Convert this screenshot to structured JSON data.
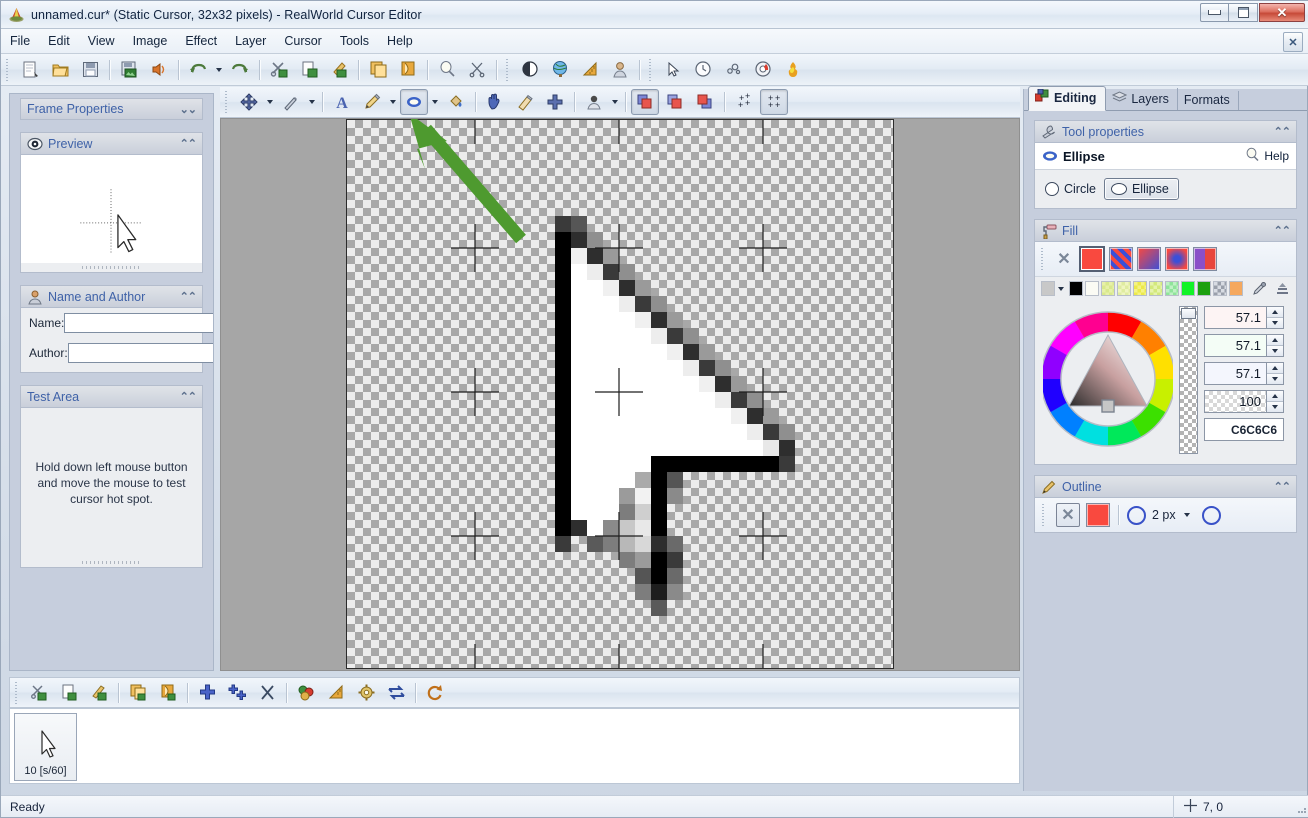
{
  "window": {
    "title": "unnamed.cur* (Static Cursor, 32x32 pixels) - RealWorld Cursor Editor",
    "app_icon": "realworld-app-icon",
    "minimize_label": "",
    "maximize_label": "",
    "close_label": "✕"
  },
  "menubar": {
    "items": [
      {
        "label": "File"
      },
      {
        "label": "Edit"
      },
      {
        "label": "View"
      },
      {
        "label": "Image"
      },
      {
        "label": "Effect"
      },
      {
        "label": "Layer"
      },
      {
        "label": "Cursor"
      },
      {
        "label": "Tools"
      },
      {
        "label": "Help"
      }
    ],
    "document_close_label": "✕"
  },
  "main_toolbar": {
    "buttons": [
      {
        "name": "new-icon",
        "tip": "New"
      },
      {
        "name": "open-folder-icon",
        "tip": "Open"
      },
      {
        "name": "save-floppy-icon",
        "tip": "Save"
      },
      {
        "name": "import-image-icon",
        "tip": "Import"
      },
      {
        "name": "sound-icon",
        "tip": "Sound"
      },
      {
        "name": "undo-icon",
        "tip": "Undo"
      },
      {
        "name": "redo-icon",
        "tip": "Redo"
      },
      {
        "name": "cut-scissors-icon",
        "tip": "Cut"
      },
      {
        "name": "copy-icon",
        "tip": "Copy"
      },
      {
        "name": "paste-brush-icon",
        "tip": "Paste"
      },
      {
        "name": "duplicate-layer-icon",
        "tip": "Duplicate"
      },
      {
        "name": "delete-layer-icon",
        "tip": "Delete"
      },
      {
        "name": "bulb-hint-icon",
        "tip": "Hint"
      },
      {
        "name": "scissors-tool-icon",
        "tip": "Trim"
      },
      {
        "name": "contrast-icon",
        "tip": "Contrast"
      },
      {
        "name": "globe-icon",
        "tip": "Globe"
      },
      {
        "name": "ruler-icon",
        "tip": "Measure"
      },
      {
        "name": "person-icon",
        "tip": "Avatar"
      },
      {
        "name": "arrow-pointer-icon",
        "tip": "Select"
      },
      {
        "name": "clock-icon",
        "tip": "Timing"
      },
      {
        "name": "bubbles-icon",
        "tip": "Effects"
      },
      {
        "name": "lifebuoy-icon",
        "tip": "Help"
      },
      {
        "name": "flame-icon",
        "tip": "Burn"
      }
    ]
  },
  "tool_options": {
    "buttons": [
      {
        "name": "move-tool-icon",
        "has_caret": true,
        "pressed": false
      },
      {
        "name": "select-wand-icon",
        "has_caret": true,
        "pressed": false
      },
      {
        "name": "text-tool-icon",
        "has_caret": false,
        "pressed": false
      },
      {
        "name": "pencil-tool-icon",
        "has_caret": true,
        "pressed": false
      },
      {
        "name": "ellipse-tool-icon",
        "has_caret": true,
        "pressed": true
      },
      {
        "name": "fill-bucket-icon",
        "has_caret": false,
        "pressed": false
      },
      {
        "name": "hand-pan-icon",
        "has_caret": false,
        "pressed": false
      },
      {
        "name": "eraser-tool-icon",
        "has_caret": false,
        "pressed": false
      },
      {
        "name": "hotspot-crosshair-icon",
        "has_caret": false,
        "pressed": false
      },
      {
        "name": "avatar-tool-icon",
        "has_caret": true,
        "pressed": false
      },
      {
        "name": "layer-front-icon",
        "has_caret": false,
        "pressed": true
      },
      {
        "name": "layer-middle-icon",
        "has_caret": false,
        "pressed": false
      },
      {
        "name": "layer-back-icon",
        "has_caret": false,
        "pressed": false
      },
      {
        "name": "grid-off-icon",
        "has_caret": false,
        "pressed": false
      },
      {
        "name": "grid-on-icon",
        "has_caret": false,
        "pressed": true
      }
    ]
  },
  "left_panel": {
    "frame_properties": {
      "title": "Frame Properties",
      "collapsed": true,
      "chevron": "⌄⌄"
    },
    "preview": {
      "title": "Preview",
      "icon": "eye-icon",
      "chevron": "⌃⌃"
    },
    "name_and_author": {
      "title": "Name and Author",
      "icon": "person-icon",
      "chevron": "⌃⌃",
      "fields": [
        {
          "label": "Name:",
          "value": "",
          "placeholder": ""
        },
        {
          "label": "Author:",
          "value": "",
          "placeholder": ""
        }
      ]
    },
    "test_area": {
      "title": "Test Area",
      "chevron": "⌃⌃",
      "instructions": "Hold down left mouse button and move the mouse to test cursor hot spot."
    }
  },
  "right_panel": {
    "tabs": [
      {
        "label": "Editing",
        "icon": "editing-cubes-icon",
        "active": true
      },
      {
        "label": "Layers",
        "icon": "layers-stack-icon",
        "active": false
      },
      {
        "label": "Formats",
        "icon": "",
        "active": false
      }
    ],
    "tool_properties": {
      "title": "Tool properties",
      "icon": "wrench-icon",
      "chevron": "⌃⌃",
      "tool_name": "Ellipse",
      "tool_icon": "ellipse-icon",
      "help_label": "Help",
      "help_icon": "bulb-icon",
      "shape_options": [
        {
          "label": "Circle",
          "selected": false
        },
        {
          "label": "Ellipse",
          "selected": true
        }
      ]
    },
    "fill": {
      "title": "Fill",
      "icon": "paint-roller-icon",
      "chevron": "⌃⌃",
      "no_fill_icon": "no-fill-x-icon",
      "styles": [
        {
          "name": "solid-fill-swatch",
          "selected": true,
          "color": "#f9493f"
        },
        {
          "name": "hatch-fill-swatch",
          "selected": false,
          "color": "#3b4fd8"
        },
        {
          "name": "linear-gradient-swatch",
          "selected": false,
          "color": "#4a3fd0"
        },
        {
          "name": "radial-gradient-swatch",
          "selected": false,
          "color": "#e8453c"
        },
        {
          "name": "diagonal-gradient-swatch",
          "selected": false,
          "color": "#6b46c8"
        }
      ],
      "palette": [
        "#c8c8c8",
        "#000000",
        "#fbfbf4",
        "#d8e98c",
        "#dfeca0",
        "#ece94a",
        "#d3e97c",
        "#8fe49a",
        "#12f327",
        "#1ca00f",
        "#b9bcc2",
        "#f5a85e"
      ],
      "palette_dropdown_icon": "chevron-down-icon",
      "eyedropper_icon": "eyedropper-icon",
      "palette_settings_icon": "palette-settings-icon",
      "channels": [
        {
          "name": "red-channel",
          "value": "57.1"
        },
        {
          "name": "green-channel",
          "value": "57.1"
        },
        {
          "name": "blue-channel",
          "value": "57.1"
        },
        {
          "name": "alpha-channel",
          "value": "100"
        }
      ],
      "hex_value": "C6C6C6",
      "hex_color": "#C6C6C6"
    },
    "outline": {
      "title": "Outline",
      "icon": "pen-icon",
      "chevron": "⌃⌃",
      "no_outline_icon": "no-outline-x-icon",
      "color": "#f9493f",
      "width_label": "2 px",
      "width_dropdown_icon": "chevron-down-icon",
      "cap_icon": "round-cap-icon"
    }
  },
  "bottom_toolbar": {
    "buttons": [
      {
        "name": "frame-cut-icon"
      },
      {
        "name": "frame-copy-icon"
      },
      {
        "name": "frame-paste-icon"
      },
      {
        "name": "frame-duplicate-icon"
      },
      {
        "name": "frame-from-file-icon"
      },
      {
        "name": "frame-add-icon"
      },
      {
        "name": "frame-add-multiple-icon"
      },
      {
        "name": "frame-delete-icon"
      },
      {
        "name": "frame-colors-icon"
      },
      {
        "name": "frame-resize-icon"
      },
      {
        "name": "frame-settings-icon"
      },
      {
        "name": "frame-reorder-icon"
      },
      {
        "name": "frame-rotate-icon"
      }
    ]
  },
  "frames": [
    {
      "label": "10 [s/60]",
      "selected": true,
      "thumb": "cursor-arrow-thumb"
    }
  ],
  "statusbar": {
    "message": "Ready",
    "coordinates": "7, 0",
    "coord_icon": "crosshair-icon"
  },
  "canvas": {
    "zoom_pixel_size": 16,
    "grid_size": 32,
    "annotation": {
      "type": "green-arrow",
      "color": "#4e9a2f"
    },
    "checker_light": "#ececec",
    "checker_dark": "#a8a8a8",
    "backdrop": "#a6a6a6"
  }
}
